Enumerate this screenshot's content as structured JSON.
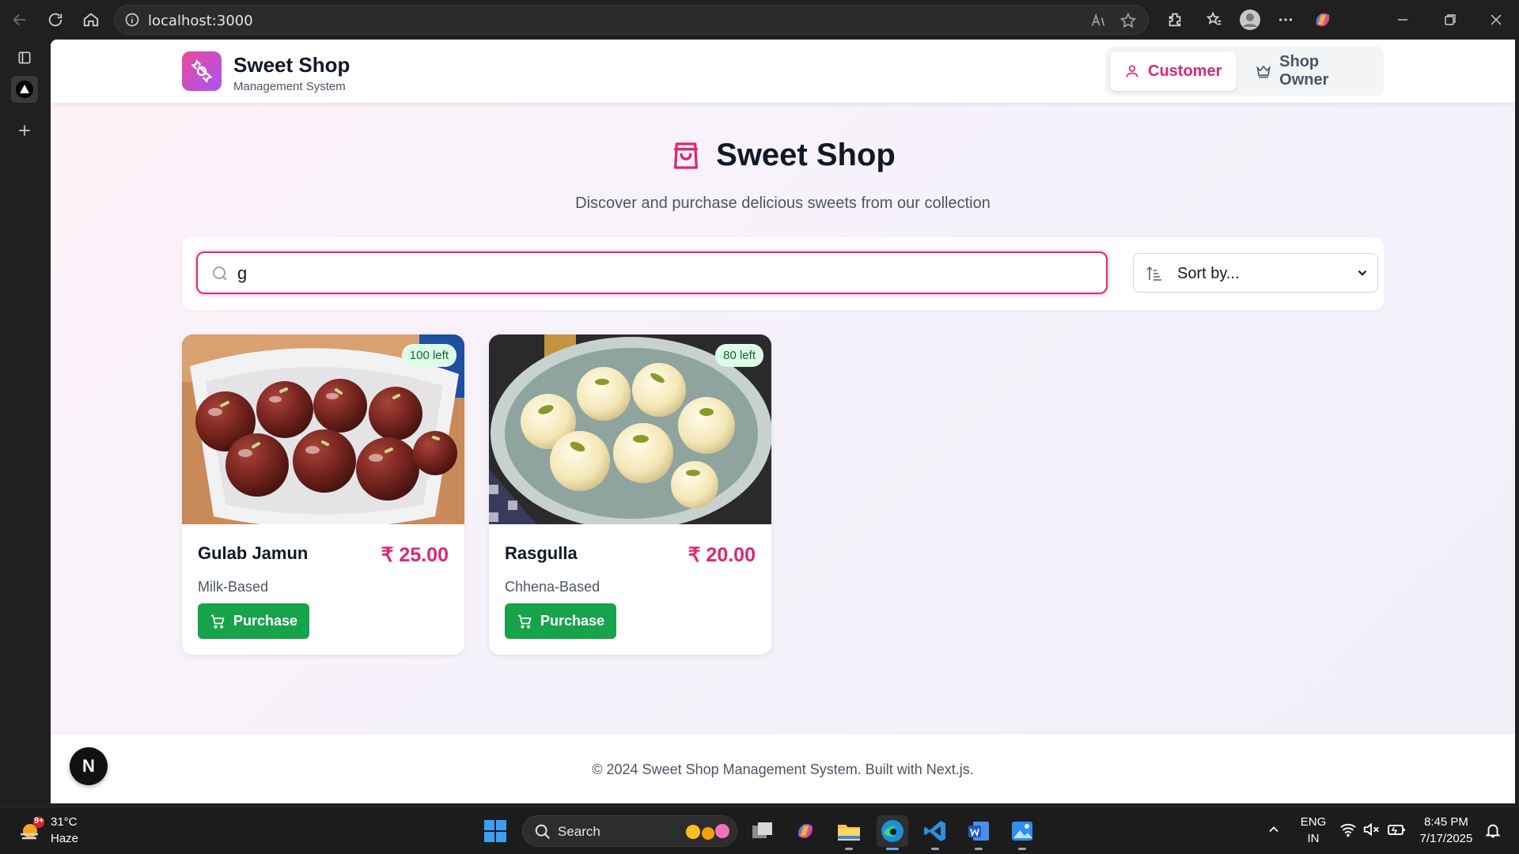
{
  "browser": {
    "url": "localhost:3000"
  },
  "header": {
    "brand_title": "Sweet Shop",
    "brand_subtitle": "Management System",
    "roles": {
      "customer": "Customer",
      "owner": "Shop Owner"
    }
  },
  "hero": {
    "title": "Sweet Shop",
    "subtitle": "Discover and purchase delicious sweets from our collection"
  },
  "filters": {
    "search_value": "g",
    "sort_label": "Sort by..."
  },
  "products": [
    {
      "name": "Gulab Jamun",
      "price": "₹ 25.00",
      "category": "Milk-Based",
      "stock": "100 left",
      "button": "Purchase"
    },
    {
      "name": "Rasgulla",
      "price": "₹ 20.00",
      "category": "Chhena-Based",
      "stock": "80 left",
      "button": "Purchase"
    }
  ],
  "footer": {
    "text": "© 2024 Sweet Shop Management System. Built with Next.js."
  },
  "dev_badge": "N",
  "taskbar": {
    "weather_temp": "31°C",
    "weather_desc": "Haze",
    "weather_badge": "9+",
    "search_label": "Search",
    "lang_line1": "ENG",
    "lang_line2": "IN",
    "time": "8:45 PM",
    "date": "7/17/2025"
  },
  "colors": {
    "accent": "#db2777",
    "purchase": "#16a34a",
    "stock_badge_bg": "#dcfce7"
  }
}
